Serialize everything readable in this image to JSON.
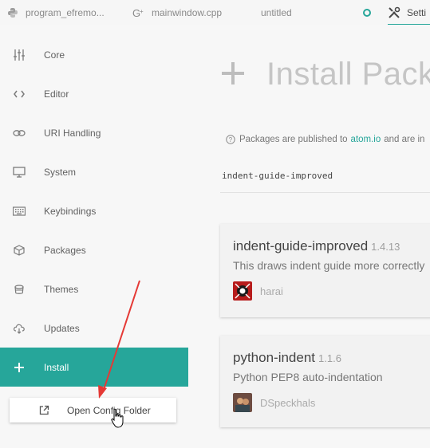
{
  "tabs": [
    {
      "label": "program_efremo...",
      "icon": "python-icon"
    },
    {
      "label": "mainwindow.cpp",
      "icon": "cpp-icon"
    },
    {
      "label": "untitled",
      "icon": ""
    },
    {
      "label": "Setti",
      "icon": "tools-icon"
    }
  ],
  "sidebar": {
    "items": [
      {
        "label": "Core",
        "icon": "sliders-icon"
      },
      {
        "label": "Editor",
        "icon": "code-icon"
      },
      {
        "label": "URI Handling",
        "icon": "link-icon"
      },
      {
        "label": "System",
        "icon": "monitor-icon"
      },
      {
        "label": "Keybindings",
        "icon": "keyboard-icon"
      },
      {
        "label": "Packages",
        "icon": "package-icon"
      },
      {
        "label": "Themes",
        "icon": "paintcan-icon"
      },
      {
        "label": "Updates",
        "icon": "cloud-download-icon"
      },
      {
        "label": "Install",
        "icon": "plus-icon"
      }
    ],
    "config_button": "Open Config Folder"
  },
  "main": {
    "title": "Install Pack",
    "notice": {
      "before": "Packages are published to",
      "link": "atom.io",
      "after": "and are in"
    },
    "search_value": "indent-guide-improved",
    "packages": [
      {
        "name": "indent-guide-improved",
        "version": "1.4.13",
        "description": "This draws indent guide more correctly",
        "author": "harai"
      },
      {
        "name": "python-indent",
        "version": "1.1.6",
        "description": "Python PEP8 auto-indentation",
        "author": "DSpeckhals"
      }
    ]
  },
  "colors": {
    "accent": "#26a69a",
    "annotation_arrow": "#e53935"
  }
}
